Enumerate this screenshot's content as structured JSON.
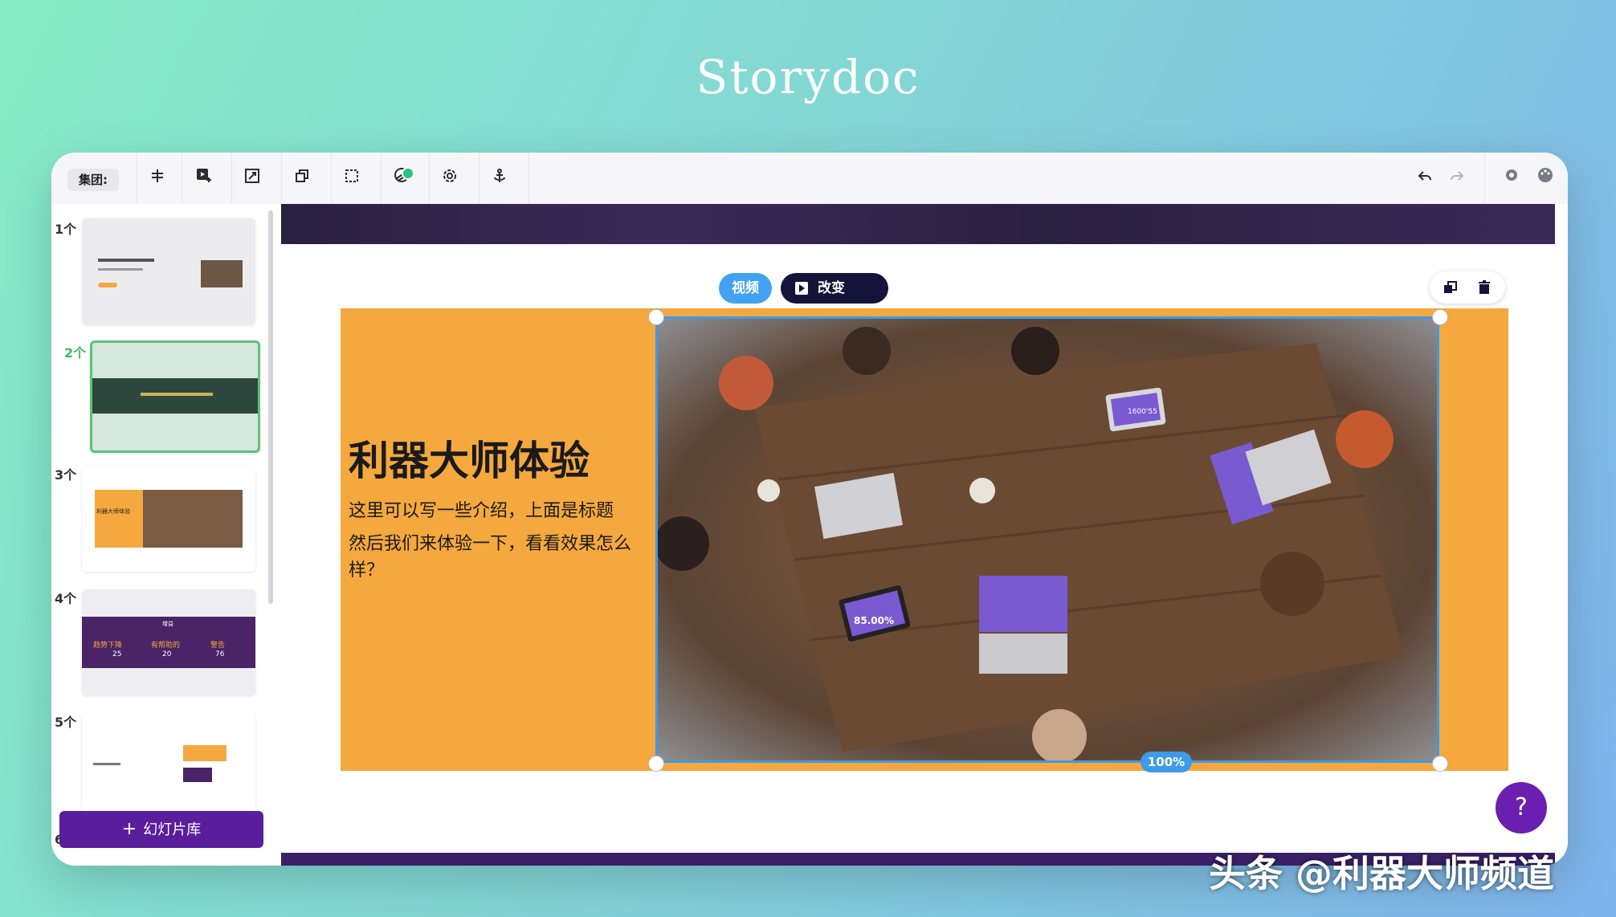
{
  "brand": {
    "title": "Storydoc"
  },
  "toolbar": {
    "group_label": "集团:",
    "icons": [
      "align-icon",
      "add-video-icon",
      "resize-icon",
      "duplicate-icon",
      "crop-icon",
      "animation-icon",
      "settings-gear-icon",
      "anchor-icon",
      "undo-icon",
      "redo-icon",
      "gear-icon",
      "palette-icon"
    ]
  },
  "sidebar": {
    "slides": [
      {
        "label": "1个",
        "title": "",
        "subtitle": ""
      },
      {
        "label": "2个"
      },
      {
        "label": "3个",
        "title": "利器大师体验"
      },
      {
        "label": "4个",
        "heading": "增益",
        "items": [
          "趋势下降",
          "有帮助的",
          "警告"
        ],
        "values": [
          "25",
          "20",
          "76"
        ]
      },
      {
        "label": "5个"
      },
      {
        "label": "6"
      }
    ],
    "library_button": "幻灯片库"
  },
  "canvas": {
    "chip_video": "视频",
    "chip_change": "改变",
    "slide": {
      "title": "利器大师体验",
      "body": [
        "这里可以写一些介绍，上面是标题",
        "然后我们来体验一下，看看效果怎么样？"
      ]
    },
    "zoom": "100%",
    "help": "?",
    "photo_screens": [
      "1600'55",
      "85.00%"
    ]
  },
  "watermark": "头条 @利器大师频道",
  "colors": {
    "accent_purple": "#5a1d9c",
    "slide_orange": "#f4a83e",
    "selection_blue": "#3f9ae8",
    "active_green": "#5cc27a"
  }
}
